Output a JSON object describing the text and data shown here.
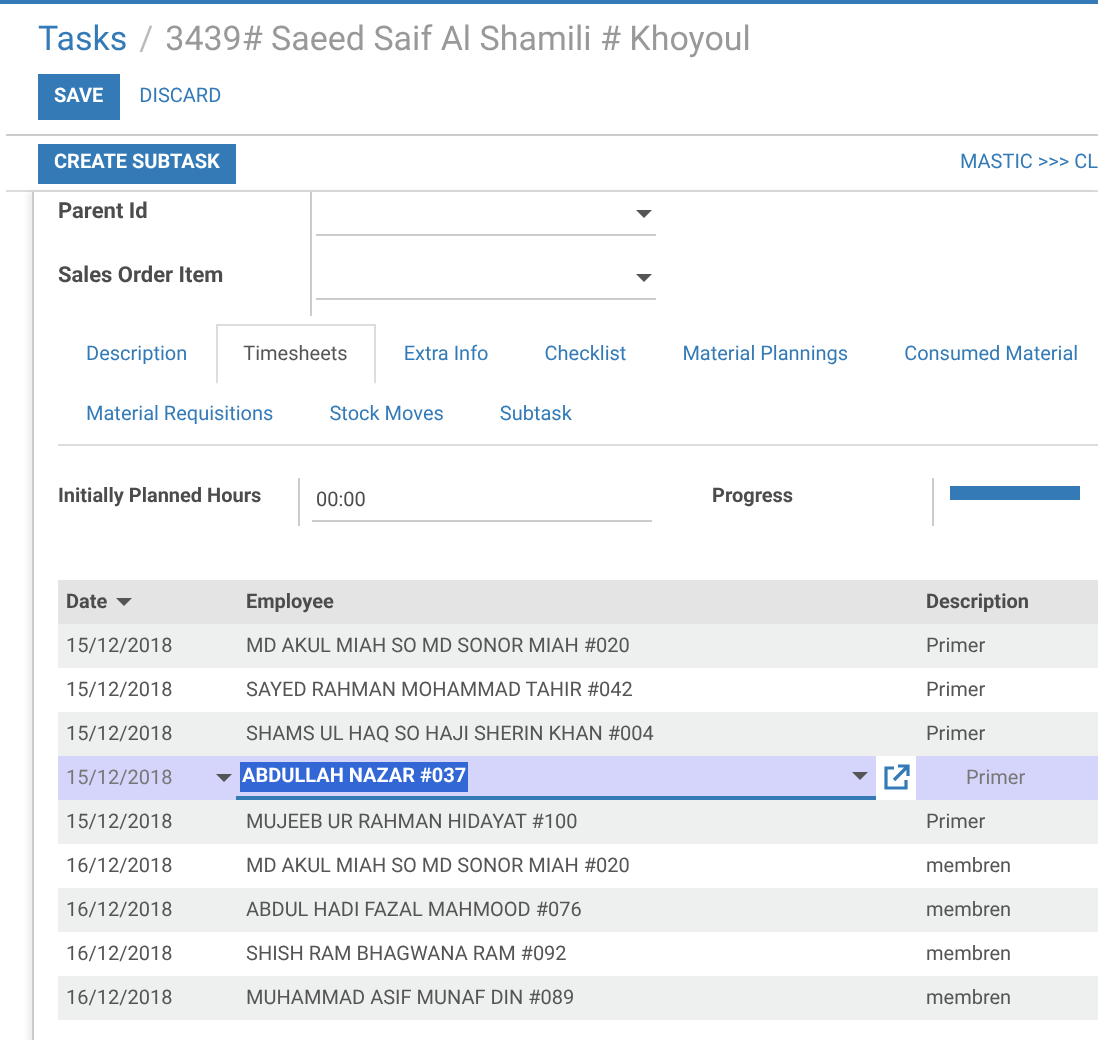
{
  "breadcrumb": {
    "parent": "Tasks",
    "separator": "/",
    "current": "3439# Saeed Saif Al Shamili # Khoyoul"
  },
  "buttons": {
    "save": "SAVE",
    "discard": "DISCARD",
    "create_subtask": "CREATE SUBTASK"
  },
  "stage": "MASTIC >>> CL",
  "fields": [
    {
      "label": "Parent Id"
    },
    {
      "label": "Sales Order Item"
    }
  ],
  "tabs": [
    {
      "label": "Description",
      "selected": false
    },
    {
      "label": "Timesheets",
      "selected": true
    },
    {
      "label": "Extra Info",
      "selected": false
    },
    {
      "label": "Checklist",
      "selected": false
    },
    {
      "label": "Material Plannings",
      "selected": false
    },
    {
      "label": "Consumed Material",
      "selected": false
    },
    {
      "label": "Material Requisitions",
      "selected": false
    },
    {
      "label": "Stock Moves",
      "selected": false
    },
    {
      "label": "Subtask",
      "selected": false
    }
  ],
  "planned_hours": {
    "label": "Initially Planned Hours",
    "value": "00:00"
  },
  "progress": {
    "label": "Progress",
    "level": 1
  },
  "table": {
    "columns": [
      "Date",
      "Employee",
      "Description"
    ],
    "rows": [
      {
        "date": "15/12/2018",
        "employee": "MD AKUL MIAH SO MD SONOR MIAH #020",
        "description": "Primer",
        "selected": false
      },
      {
        "date": "15/12/2018",
        "employee": "SAYED RAHMAN MOHAMMAD TAHIR #042",
        "description": "Primer",
        "selected": false
      },
      {
        "date": "15/12/2018",
        "employee": "SHAMS UL HAQ SO HAJI SHERIN KHAN #004",
        "description": "Primer",
        "selected": false
      },
      {
        "date": "15/12/2018",
        "employee": "ABDULLAH NAZAR #037",
        "description": "Primer",
        "selected": true
      },
      {
        "date": "15/12/2018",
        "employee": "MUJEEB UR RAHMAN HIDAYAT #100",
        "description": "Primer",
        "selected": false
      },
      {
        "date": "16/12/2018",
        "employee": "MD AKUL MIAH SO MD SONOR MIAH #020",
        "description": "membren",
        "selected": false
      },
      {
        "date": "16/12/2018",
        "employee": "ABDUL HADI FAZAL MAHMOOD #076",
        "description": "membren",
        "selected": false
      },
      {
        "date": "16/12/2018",
        "employee": "SHISH RAM BHAGWANA RAM #092",
        "description": "membren",
        "selected": false
      },
      {
        "date": "16/12/2018",
        "employee": "MUHAMMAD ASIF MUNAF DIN #089",
        "description": "membren",
        "selected": false
      }
    ]
  }
}
